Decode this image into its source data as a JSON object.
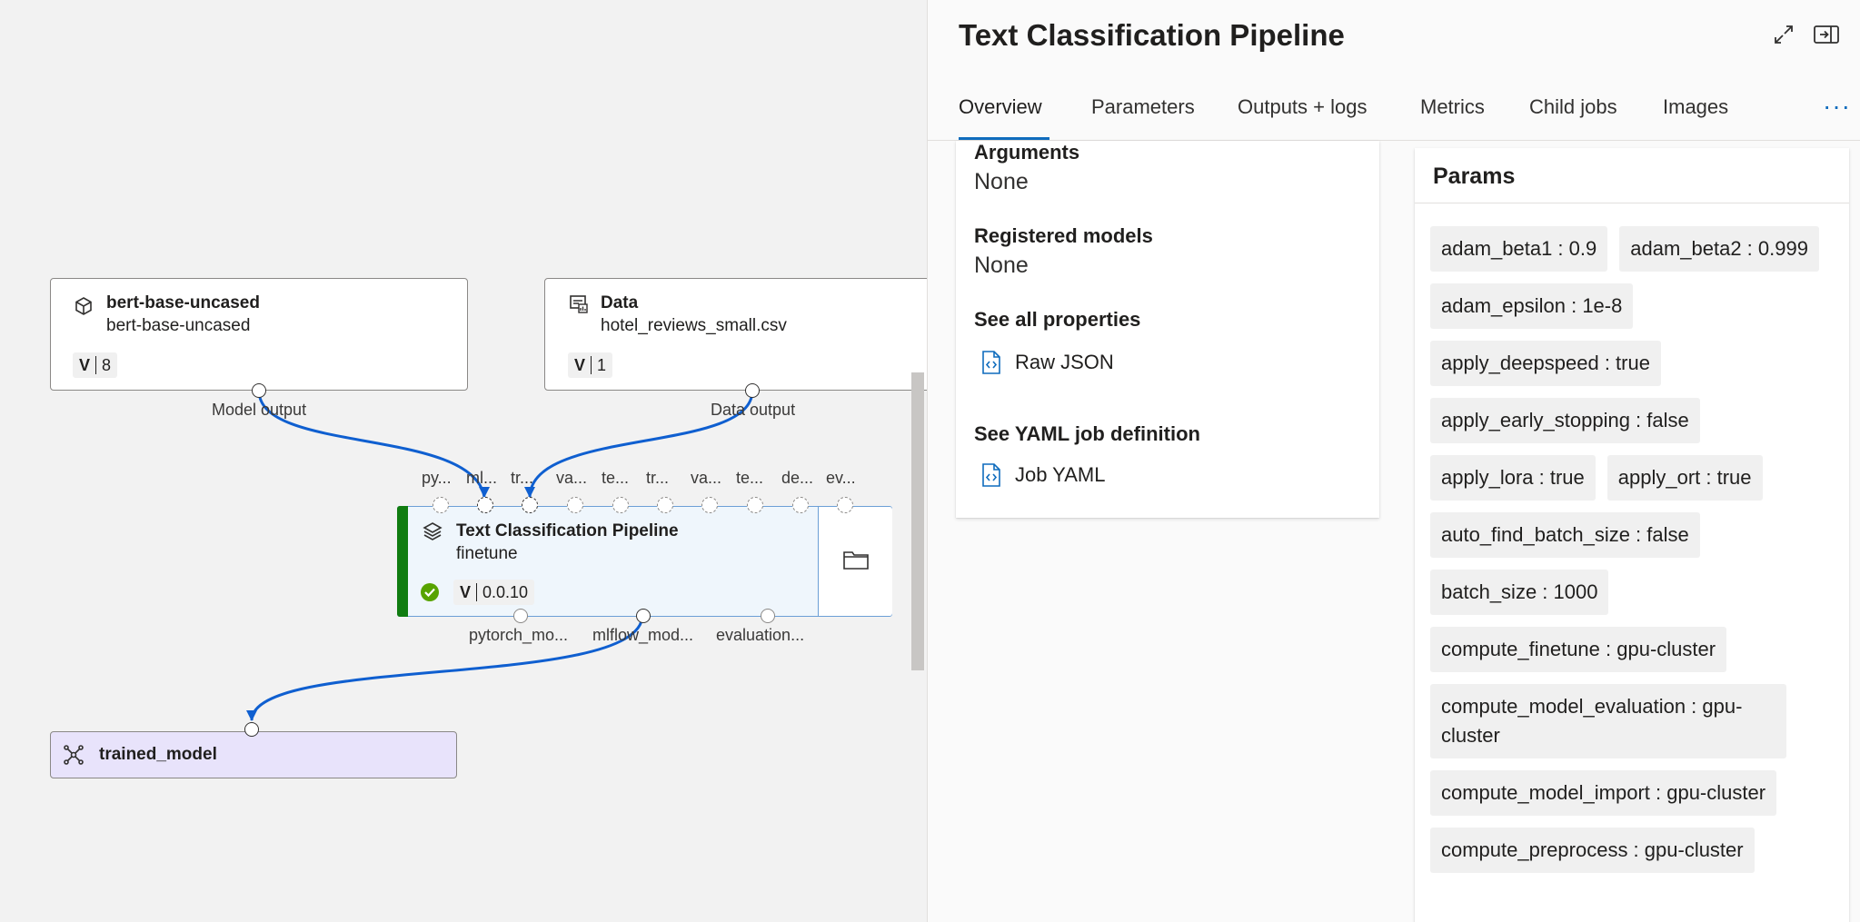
{
  "canvas": {
    "nodes": {
      "bert": {
        "title": "bert-base-uncased",
        "subtitle": "bert-base-uncased",
        "version_prefix": "V",
        "version": "8",
        "output_label": "Model output",
        "icon": "cube-icon"
      },
      "data": {
        "title": "Data",
        "subtitle": "hotel_reviews_small.csv",
        "version_prefix": "V",
        "version": "1",
        "output_label": "Data output",
        "icon": "dataset-icon"
      },
      "pipeline": {
        "title": "Text Classification Pipeline",
        "subtitle": "finetune",
        "version_prefix": "V",
        "version": "0.0.10",
        "icon": "layers-icon",
        "status_icon": "check-circle-icon",
        "input_labels": [
          "py...",
          "ml...",
          "tr...",
          "va...",
          "te...",
          "tr...",
          "va...",
          "te...",
          "de...",
          "ev..."
        ],
        "output_labels": [
          "pytorch_mo...",
          "mlflow_mod...",
          "evaluation..."
        ],
        "side_icon": "folder-icon"
      },
      "trained": {
        "title": "trained_model",
        "icon": "network-icon"
      }
    },
    "colors": {
      "edge": "#0f5fd0",
      "status_bar": "#107c10",
      "trained_bg": "#e8e3fb"
    }
  },
  "panel": {
    "title": "Text Classification Pipeline",
    "header_icons": [
      "expand-icon",
      "dock-right-icon"
    ],
    "tabs": [
      "Overview",
      "Parameters",
      "Outputs + logs",
      "Metrics",
      "Child jobs",
      "Images"
    ],
    "active_tab": "Overview",
    "more_label": "···",
    "properties": {
      "arguments_label": "Arguments",
      "arguments_value": "None",
      "registered_models_label": "Registered models",
      "registered_models_value": "None",
      "see_all_label": "See all properties",
      "raw_json_label": "Raw JSON",
      "see_yaml_label": "See YAML job definition",
      "job_yaml_label": "Job YAML"
    },
    "params": {
      "title": "Params",
      "items": [
        "adam_beta1 : 0.9",
        "adam_beta2 : 0.999",
        "adam_epsilon : 1e-8",
        "apply_deepspeed : true",
        "apply_early_stopping : false",
        "apply_lora : true",
        "apply_ort : true",
        "auto_find_batch_size : false",
        "batch_size : 1000",
        "compute_finetune : gpu-cluster",
        "compute_model_evaluation : gpu-cluster",
        "compute_model_import : gpu-cluster",
        "compute_preprocess : gpu-cluster"
      ]
    },
    "accent_color": "#0f6cbd"
  }
}
